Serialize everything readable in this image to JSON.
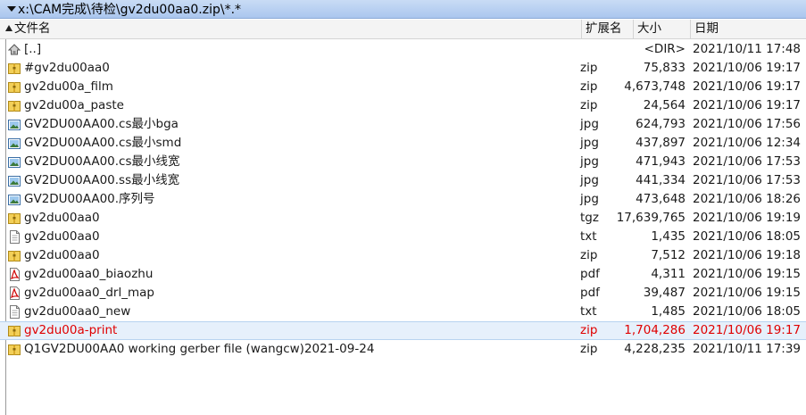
{
  "path": "x:\\CAM完成\\待检\\gv2du00aa0.zip\\*.*",
  "columns": {
    "name": "文件名",
    "ext": "扩展名",
    "size": "大小",
    "date": "日期"
  },
  "files": [
    {
      "icon": "up-dir-icon",
      "name": "[..]",
      "ext": "",
      "size": "<DIR>",
      "date": "2021/10/11 17:48",
      "selected": false
    },
    {
      "icon": "archive-icon",
      "name": "#gv2du00aa0",
      "ext": "zip",
      "size": "75,833",
      "date": "2021/10/06 19:17",
      "selected": false
    },
    {
      "icon": "archive-icon",
      "name": "gv2du00a_film",
      "ext": "zip",
      "size": "4,673,748",
      "date": "2021/10/06 19:17",
      "selected": false
    },
    {
      "icon": "archive-icon",
      "name": "gv2du00a_paste",
      "ext": "zip",
      "size": "24,564",
      "date": "2021/10/06 19:17",
      "selected": false
    },
    {
      "icon": "image-icon",
      "name": "GV2DU00AA00.cs最小bga",
      "ext": "jpg",
      "size": "624,793",
      "date": "2021/10/06 17:56",
      "selected": false
    },
    {
      "icon": "image-icon",
      "name": "GV2DU00AA00.cs最小smd",
      "ext": "jpg",
      "size": "437,897",
      "date": "2021/10/06 12:34",
      "selected": false
    },
    {
      "icon": "image-icon",
      "name": "GV2DU00AA00.cs最小线宽",
      "ext": "jpg",
      "size": "471,943",
      "date": "2021/10/06 17:53",
      "selected": false
    },
    {
      "icon": "image-icon",
      "name": "GV2DU00AA00.ss最小线宽",
      "ext": "jpg",
      "size": "441,334",
      "date": "2021/10/06 17:53",
      "selected": false
    },
    {
      "icon": "image-icon",
      "name": "GV2DU00AA00.序列号",
      "ext": "jpg",
      "size": "473,648",
      "date": "2021/10/06 18:26",
      "selected": false
    },
    {
      "icon": "archive-icon",
      "name": "gv2du00aa0",
      "ext": "tgz",
      "size": "17,639,765",
      "date": "2021/10/06 19:19",
      "selected": false
    },
    {
      "icon": "text-file-icon",
      "name": "gv2du00aa0",
      "ext": "txt",
      "size": "1,435",
      "date": "2021/10/06 18:05",
      "selected": false
    },
    {
      "icon": "archive-icon",
      "name": "gv2du00aa0",
      "ext": "zip",
      "size": "7,512",
      "date": "2021/10/06 19:18",
      "selected": false
    },
    {
      "icon": "pdf-icon",
      "name": "gv2du00aa0_biaozhu",
      "ext": "pdf",
      "size": "4,311",
      "date": "2021/10/06 19:15",
      "selected": false
    },
    {
      "icon": "pdf-icon",
      "name": "gv2du00aa0_drl_map",
      "ext": "pdf",
      "size": "39,487",
      "date": "2021/10/06 19:15",
      "selected": false
    },
    {
      "icon": "text-file-icon",
      "name": "gv2du00aa0_new",
      "ext": "txt",
      "size": "1,485",
      "date": "2021/10/06 18:05",
      "selected": false
    },
    {
      "icon": "archive-icon",
      "name": "gv2du00a-print",
      "ext": "zip",
      "size": "1,704,286",
      "date": "2021/10/06 19:17",
      "selected": true
    },
    {
      "icon": "archive-icon",
      "name": "Q1GV2DU00AA0 working gerber file (wangcw)2021-09-24",
      "ext": "zip",
      "size": "4,228,235",
      "date": "2021/10/11 17:39",
      "selected": false
    }
  ]
}
